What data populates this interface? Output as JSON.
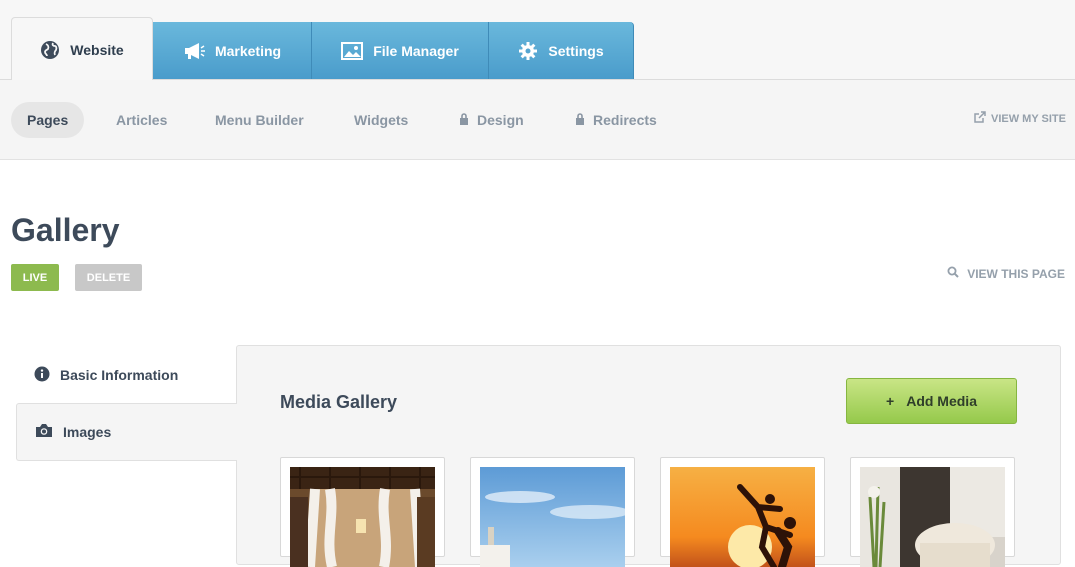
{
  "tabs": [
    {
      "label": "Website",
      "icon": "globe-icon"
    },
    {
      "label": "Marketing",
      "icon": "megaphone-icon"
    },
    {
      "label": "File Manager",
      "icon": "image-icon"
    },
    {
      "label": "Settings",
      "icon": "gear-icon"
    }
  ],
  "subnav": {
    "items": [
      "Pages",
      "Articles",
      "Menu Builder",
      "Widgets",
      "Design",
      "Redirects"
    ],
    "view_site": "VIEW MY SITE"
  },
  "page": {
    "title": "Gallery",
    "live": "LIVE",
    "delete": "DELETE",
    "view_page": "VIEW THIS PAGE"
  },
  "side_tabs": {
    "basic": "Basic Information",
    "images": "Images"
  },
  "gallery": {
    "title": "Media Gallery",
    "add_label": "Add Media",
    "add_icon": "+"
  },
  "colors": {
    "tab_blue": "#5aaad5",
    "live_green": "#8dba4e",
    "add_green": "#a9d45f"
  }
}
